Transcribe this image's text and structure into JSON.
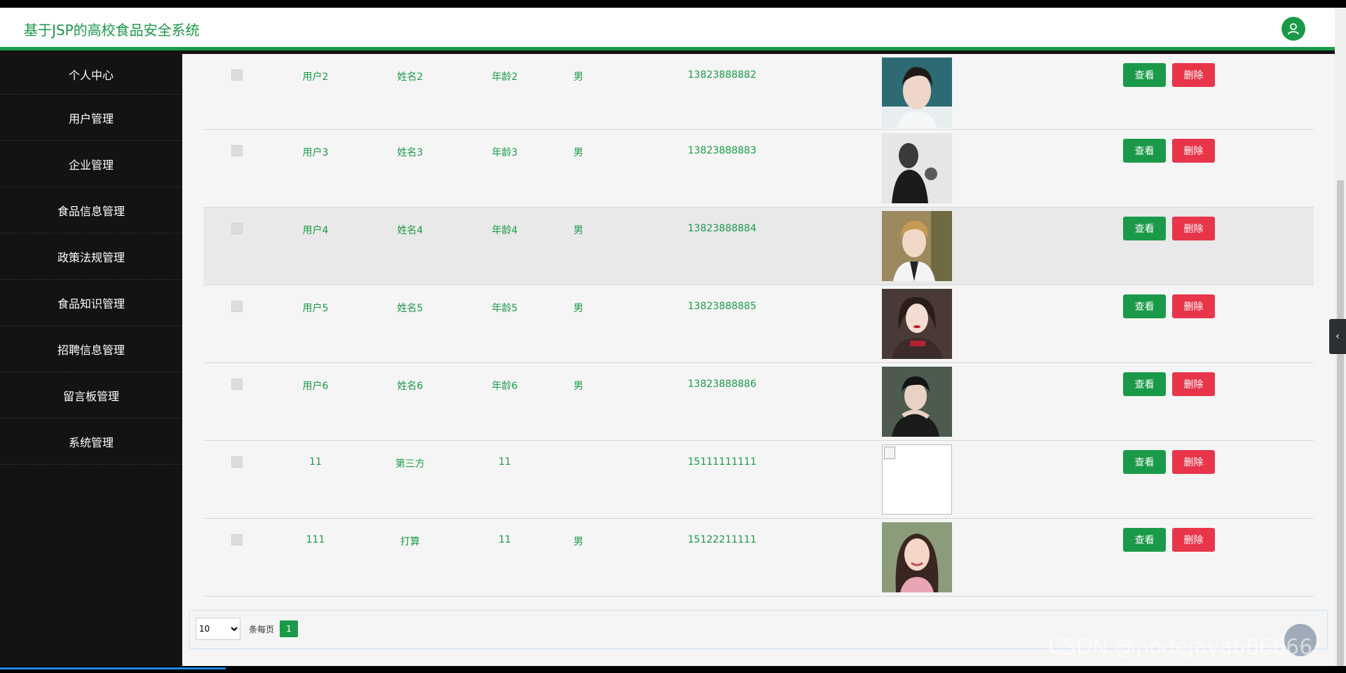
{
  "header": {
    "title": "基于JSP的高校食品安全系统"
  },
  "sidebar": {
    "items": [
      {
        "label": "个人中心"
      },
      {
        "label": "用户管理"
      },
      {
        "label": "企业管理"
      },
      {
        "label": "食品信息管理"
      },
      {
        "label": "政策法规管理"
      },
      {
        "label": "食品知识管理"
      },
      {
        "label": "招聘信息管理"
      },
      {
        "label": "留言板管理"
      },
      {
        "label": "系统管理"
      }
    ]
  },
  "table": {
    "rows": [
      {
        "user": "用户2",
        "name": "姓名2",
        "age": "年龄2",
        "sex": "男",
        "phone": "13823888882",
        "photo": "portrait-male-white-turtleneck"
      },
      {
        "user": "用户3",
        "name": "姓名3",
        "age": "年龄3",
        "sex": "男",
        "phone": "13823888883",
        "photo": "portrait-male-bw"
      },
      {
        "user": "用户4",
        "name": "姓名4",
        "age": "年龄4",
        "sex": "男",
        "phone": "13823888884",
        "photo": "portrait-male-blond"
      },
      {
        "user": "用户5",
        "name": "姓名5",
        "age": "年龄5",
        "sex": "男",
        "phone": "13823888885",
        "photo": "portrait-female-red-lips"
      },
      {
        "user": "用户6",
        "name": "姓名6",
        "age": "年龄6",
        "sex": "男",
        "phone": "13823888886",
        "photo": "portrait-male-dark"
      },
      {
        "user": "11",
        "name": "第三方",
        "age": "11",
        "sex": "",
        "phone": "15111111111",
        "photo": "broken-image"
      },
      {
        "user": "111",
        "name": "打算",
        "age": "11",
        "sex": "男",
        "phone": "15122211111",
        "photo": "portrait-female-smiling"
      }
    ],
    "view_label": "查看",
    "delete_label": "删除"
  },
  "pager": {
    "page_size": "10",
    "per_page_label": "条每页",
    "current_page": "1"
  },
  "watermark": "CSDN @nodejava666666",
  "colors": {
    "accent": "#1a9a48",
    "danger": "#e8354a",
    "sidebar_bg": "#141314"
  }
}
